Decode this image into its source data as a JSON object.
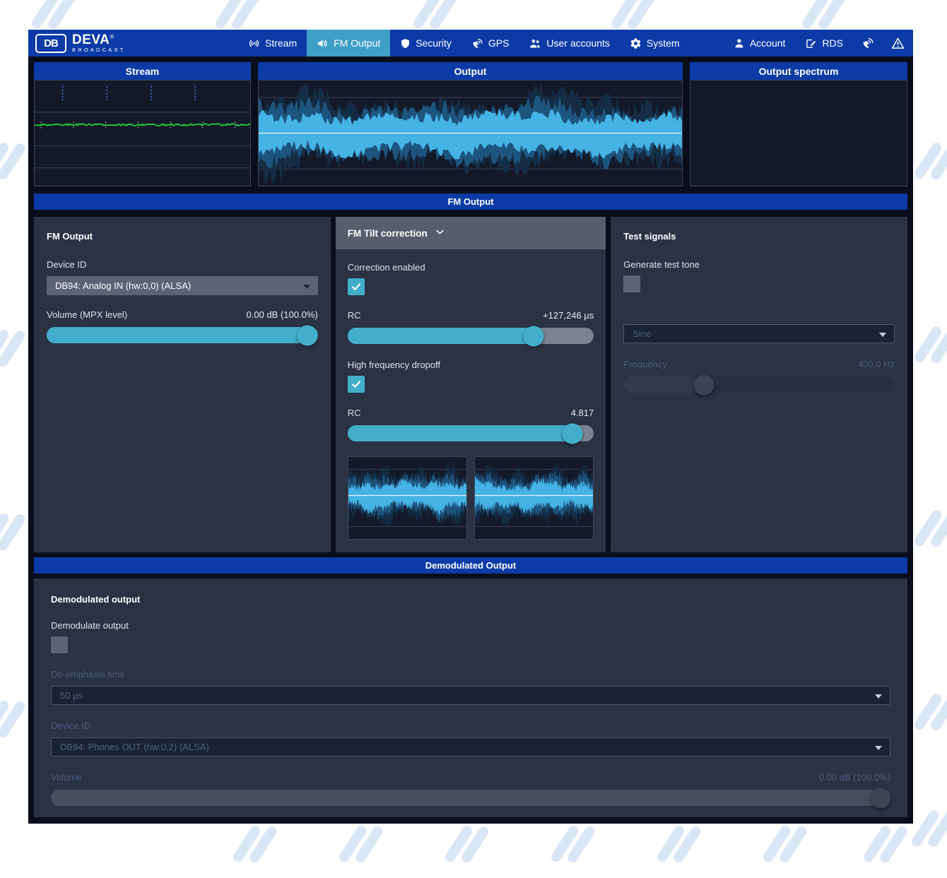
{
  "nav": {
    "brand": {
      "logo_text": "DB",
      "name": "DEVA",
      "registered": "®",
      "sub": "BROADCAST"
    },
    "items": [
      {
        "label": "Stream"
      },
      {
        "label": "FM Output"
      },
      {
        "label": "Security"
      },
      {
        "label": "GPS"
      },
      {
        "label": "User accounts"
      },
      {
        "label": "System"
      }
    ],
    "right_items": [
      {
        "label": "Account"
      },
      {
        "label": "RDS"
      }
    ]
  },
  "monitors": [
    {
      "title": "Stream",
      "type": "waveform-flatline"
    },
    {
      "title": "Output",
      "type": "waveform"
    },
    {
      "title": "Output spectrum",
      "type": "spectrum"
    }
  ],
  "sections": {
    "fm_output": "FM Output",
    "demodulated": "Demodulated Output"
  },
  "fm_output_panel": {
    "title": "FM Output",
    "device_id_label": "Device ID",
    "device_id_value": "DB94: Analog IN (hw:0,0) (ALSA)",
    "volume_label": "Volume (MPX level)",
    "volume_value": "0.00 dB (100.0%)",
    "volume_percent": 100
  },
  "tilt_panel": {
    "title": "FM Tilt correction",
    "correction_label": "Correction enabled",
    "correction_checked": true,
    "rc1_label": "RC",
    "rc1_value": "+127,246 µs",
    "rc1_percent": 78,
    "dropoff_label": "High frequency dropoff",
    "dropoff_checked": true,
    "rc2_label": "RC",
    "rc2_value": "4.817",
    "rc2_percent": 95
  },
  "test_signals_panel": {
    "title": "Test signals",
    "tone_label": "Generate test tone",
    "tone_checked": false,
    "waveform_value": "Sine",
    "frequency_label": "Frequency",
    "frequency_value": "400.0 Hz",
    "frequency_percent": 28
  },
  "demodulated_panel": {
    "title": "Demodulated output",
    "demodulate_label": "Demodulate output",
    "demodulate_checked": false,
    "deemphasis_label": "De-emphasis time",
    "deemphasis_value": "50 µs",
    "device_id_label": "Device ID",
    "device_id_value": "DB94: Phones OUT (hw:0,2) (ALSA)",
    "volume_label": "Volume",
    "volume_value": "0.00 dB (100.0%)",
    "volume_percent": 100
  },
  "colors": {
    "nav_blue": "#0c3ba7",
    "active_tab": "#3f9fc7",
    "accent_teal": "#43aeca",
    "panel_bg": "#2a3244",
    "app_bg": "#0a0e1b",
    "wave_cyan": "#45b3e4",
    "stream_green": "#25e43e",
    "spectrum_red": "#330e13"
  }
}
